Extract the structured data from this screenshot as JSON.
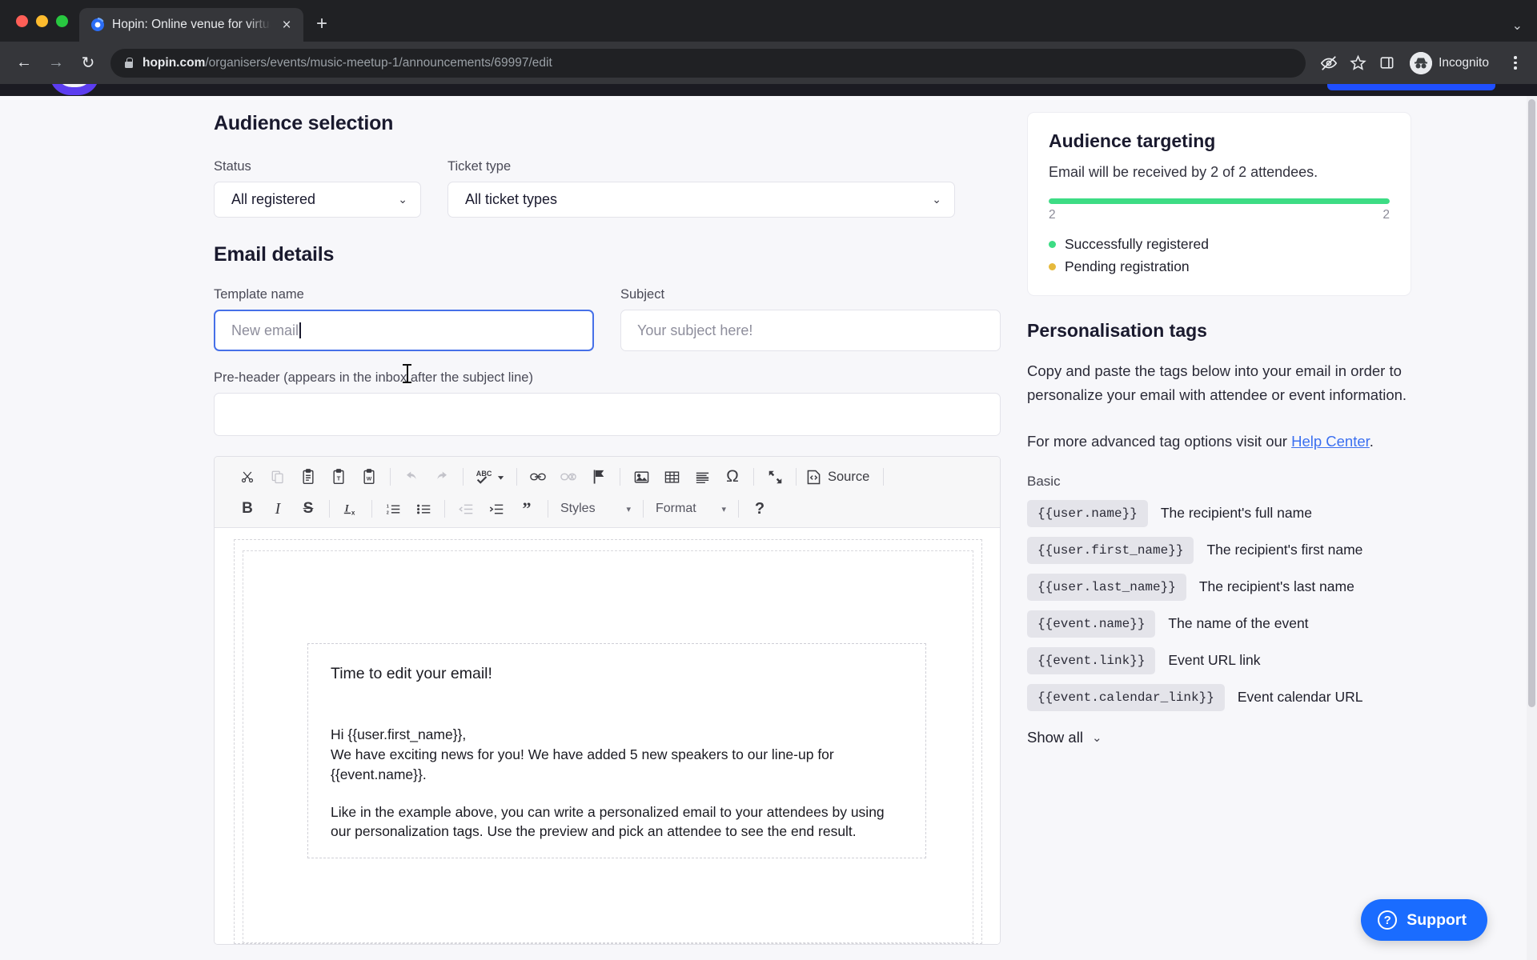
{
  "browser": {
    "tab": {
      "title": "Hopin: Online venue for virtual",
      "favicon": "hopin-favicon",
      "close_label": "×"
    },
    "new_tab_label": "+",
    "tab_list_chevron": "⌄",
    "nav": {
      "back": "←",
      "forward": "→",
      "reload": "↻"
    },
    "url": {
      "domain": "hopin.com",
      "path": "/organisers/events/music-meetup-1/announcements/69997/edit"
    },
    "profile_label": "Incognito",
    "toolbar_icons": [
      "eye-slash-icon",
      "star-icon",
      "side-panel-icon"
    ],
    "menu_label": "⋮"
  },
  "audience_selection": {
    "heading": "Audience selection",
    "status": {
      "label": "Status",
      "value": "All registered",
      "chevron": "⌄"
    },
    "ticket_type": {
      "label": "Ticket type",
      "value": "All ticket types",
      "chevron": "⌄"
    }
  },
  "email_details": {
    "heading": "Email details",
    "template_name": {
      "label": "Template name",
      "placeholder": "New email",
      "value": ""
    },
    "subject": {
      "label": "Subject",
      "placeholder": "Your subject here!",
      "value": ""
    },
    "preheader": {
      "label": "Pre-header (appears in the inbox after the subject line)",
      "value": ""
    }
  },
  "editor": {
    "row1": [
      {
        "name": "cut-icon",
        "glyph": "✂",
        "dim": false
      },
      {
        "name": "copy-icon",
        "glyph": "❐",
        "dim": true
      },
      {
        "name": "paste-icon",
        "glyph": "ὌB",
        "dim": false
      },
      {
        "name": "paste-as-text-icon",
        "glyph": "T",
        "dim": false
      },
      {
        "name": "paste-from-word-icon",
        "glyph": "W",
        "dim": false
      },
      {
        "name": "undo-icon",
        "glyph": "↩",
        "dim": true
      },
      {
        "name": "redo-icon",
        "glyph": "↪",
        "dim": true
      },
      {
        "name": "spellcheck-icon",
        "glyph": "ABC",
        "dim": false
      },
      {
        "name": "link-icon",
        "glyph": "⚭",
        "dim": false
      },
      {
        "name": "unlink-icon",
        "glyph": "⚭",
        "dim": true
      },
      {
        "name": "anchor-flag-icon",
        "glyph": "⚑",
        "dim": false
      },
      {
        "name": "image-icon",
        "glyph": "ὛC",
        "dim": false
      },
      {
        "name": "table-icon",
        "glyph": "▦",
        "dim": false
      },
      {
        "name": "horizontal-rule-icon",
        "glyph": "≡",
        "dim": false
      },
      {
        "name": "special-character-icon",
        "glyph": "Ω",
        "dim": false
      },
      {
        "name": "maximize-icon",
        "glyph": "⤡",
        "dim": false
      }
    ],
    "source_label": "Source",
    "row2": [
      {
        "name": "bold-icon",
        "glyph": "B",
        "dim": false
      },
      {
        "name": "italic-icon",
        "glyph": "I",
        "dim": false
      },
      {
        "name": "strikethrough-icon",
        "glyph": "S",
        "dim": false
      },
      {
        "name": "remove-format-icon",
        "glyph": "Iₓ",
        "dim": false
      },
      {
        "name": "numbered-list-icon",
        "glyph": "≡",
        "dim": false
      },
      {
        "name": "bulleted-list-icon",
        "glyph": "≡",
        "dim": false
      },
      {
        "name": "outdent-icon",
        "glyph": "≡",
        "dim": true
      },
      {
        "name": "indent-icon",
        "glyph": "≡",
        "dim": false
      },
      {
        "name": "blockquote-icon",
        "glyph": "”",
        "dim": false
      }
    ],
    "styles_label": "Styles",
    "format_label": "Format",
    "help_label": "?",
    "dropdown_caret": "▾",
    "body": {
      "heading": "Time to edit your email!",
      "paragraphs": [
        "Hi {{user.first_name}},",
        "We have exciting news for you! We have added 5 new speakers to our line-up for {{event.name}}.",
        "Like in the example above, you can write a personalized email to your attendees by using our personalization tags. Use the preview and pick an attendee to see the end result."
      ]
    }
  },
  "audience_targeting": {
    "title": "Audience targeting",
    "subtitle": "Email will be received by 2 of 2 attendees.",
    "progress_percent": 100,
    "left_value": "2",
    "right_value": "2",
    "legend": [
      {
        "label": "Successfully registered",
        "color": "#3ddc84"
      },
      {
        "label": "Pending registration",
        "color": "#e6b93c"
      }
    ]
  },
  "personalisation": {
    "title": "Personalisation tags",
    "intro": "Copy and paste the tags below into your email in order to personalize your email with attendee or event information.",
    "help_prefix": "For more advanced tag options visit our ",
    "help_link": "Help Center",
    "help_suffix": ".",
    "group_label": "Basic",
    "tags": [
      {
        "tag": "{{user.name}}",
        "desc": "The recipient's full name"
      },
      {
        "tag": "{{user.first_name}}",
        "desc": "The recipient's first name"
      },
      {
        "tag": "{{user.last_name}}",
        "desc": "The recipient's last name"
      },
      {
        "tag": "{{event.name}}",
        "desc": "The name of the event"
      },
      {
        "tag": "{{event.link}}",
        "desc": "Event URL link"
      },
      {
        "tag": "{{event.calendar_link}}",
        "desc": "Event calendar URL"
      }
    ],
    "show_all_label": "Show all",
    "show_all_chevron": "⌄"
  },
  "support": {
    "label": "Support",
    "icon_glyph": "?",
    "color": "#1a6cff"
  }
}
